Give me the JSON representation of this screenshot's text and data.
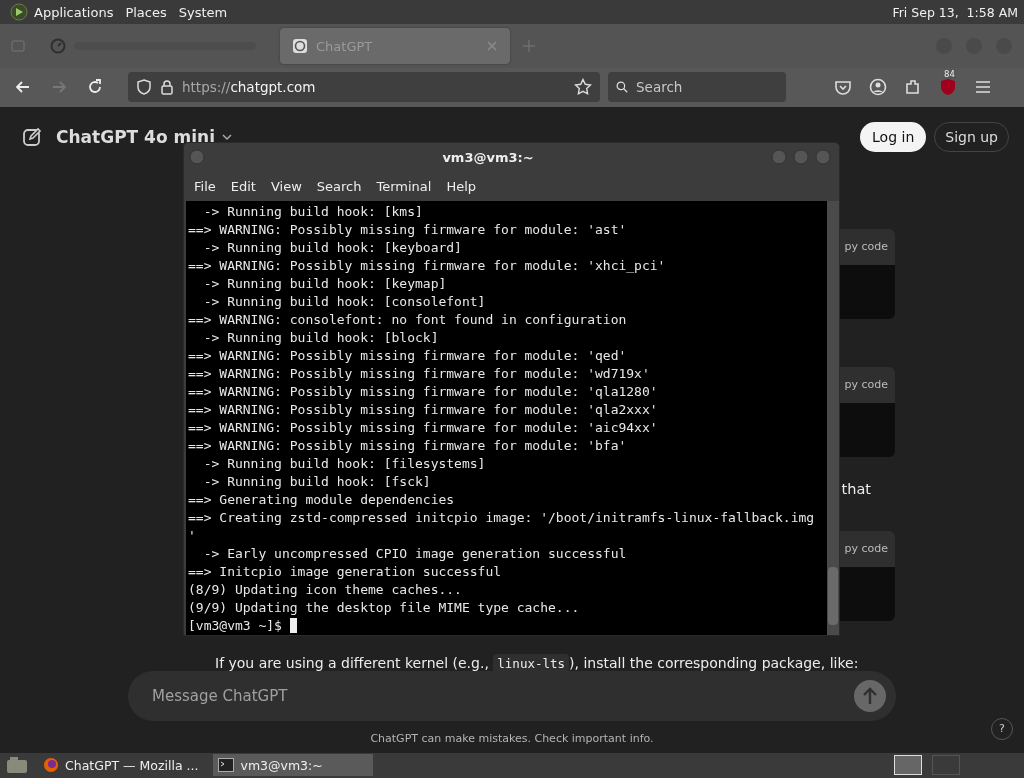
{
  "top_panel": {
    "menus": [
      "Applications",
      "Places",
      "System"
    ],
    "clock": "Fri Sep 13,  1:58 AM"
  },
  "browser": {
    "tabs": [
      {
        "kind": "blurred",
        "selected": false
      },
      {
        "kind": "page",
        "label": "ChatGPT",
        "selected": true
      }
    ],
    "nav": {
      "forward_disabled": true,
      "url_scheme": "https://",
      "url_host": "chatgpt.com",
      "search_placeholder": "Search",
      "badge": "84"
    }
  },
  "page": {
    "model": "ChatGPT 4o mini",
    "login": "Log in",
    "signup": "Sign up",
    "blocks": [
      {
        "kind": "code",
        "copy": "py code"
      },
      {
        "kind": "code",
        "copy": "py code"
      },
      {
        "kind": "tail",
        "text": "that"
      },
      {
        "kind": "code",
        "copy": "py code"
      },
      {
        "kind": "para",
        "parts": [
          {
            "kind": "text",
            "text": "If you are using a different kernel (e.g., "
          },
          {
            "kind": "code",
            "text": "linux-lts"
          },
          {
            "kind": "text",
            "text": "), install the corresponding package, like:"
          }
        ]
      }
    ],
    "message": {
      "placeholder": "Message ChatGPT"
    },
    "disclaimer": "ChatGPT can make mistakes. Check important info.",
    "help": "?"
  },
  "terminal": {
    "title": "vm3@vm3:~",
    "menus": [
      "File",
      "Edit",
      "View",
      "Search",
      "Terminal",
      "Help"
    ],
    "lines": [
      "  -> Running build hook: [kms]",
      "==> WARNING: Possibly missing firmware for module: 'ast'",
      "  -> Running build hook: [keyboard]",
      "==> WARNING: Possibly missing firmware for module: 'xhci_pci'",
      "  -> Running build hook: [keymap]",
      "  -> Running build hook: [consolefont]",
      "==> WARNING: consolefont: no font found in configuration",
      "  -> Running build hook: [block]",
      "==> WARNING: Possibly missing firmware for module: 'qed'",
      "==> WARNING: Possibly missing firmware for module: 'wd719x'",
      "==> WARNING: Possibly missing firmware for module: 'qla1280'",
      "==> WARNING: Possibly missing firmware for module: 'qla2xxx'",
      "==> WARNING: Possibly missing firmware for module: 'aic94xx'",
      "==> WARNING: Possibly missing firmware for module: 'bfa'",
      "  -> Running build hook: [filesystems]",
      "  -> Running build hook: [fsck]",
      "==> Generating module dependencies",
      "==> Creating zstd-compressed initcpio image: '/boot/initramfs-linux-fallback.img",
      "'",
      "  -> Early uncompressed CPIO image generation successful",
      "==> Initcpio image generation successful",
      "(8/9) Updating icon theme caches...",
      "(9/9) Updating the desktop file MIME type cache..."
    ],
    "prompt": "[vm3@vm3 ~]$ "
  },
  "taskbar": {
    "tasks": [
      {
        "kind": "browser",
        "label": "ChatGPT — Mozilla ...",
        "selected": false
      },
      {
        "kind": "terminal",
        "label": "vm3@vm3:~",
        "selected": true
      }
    ]
  }
}
